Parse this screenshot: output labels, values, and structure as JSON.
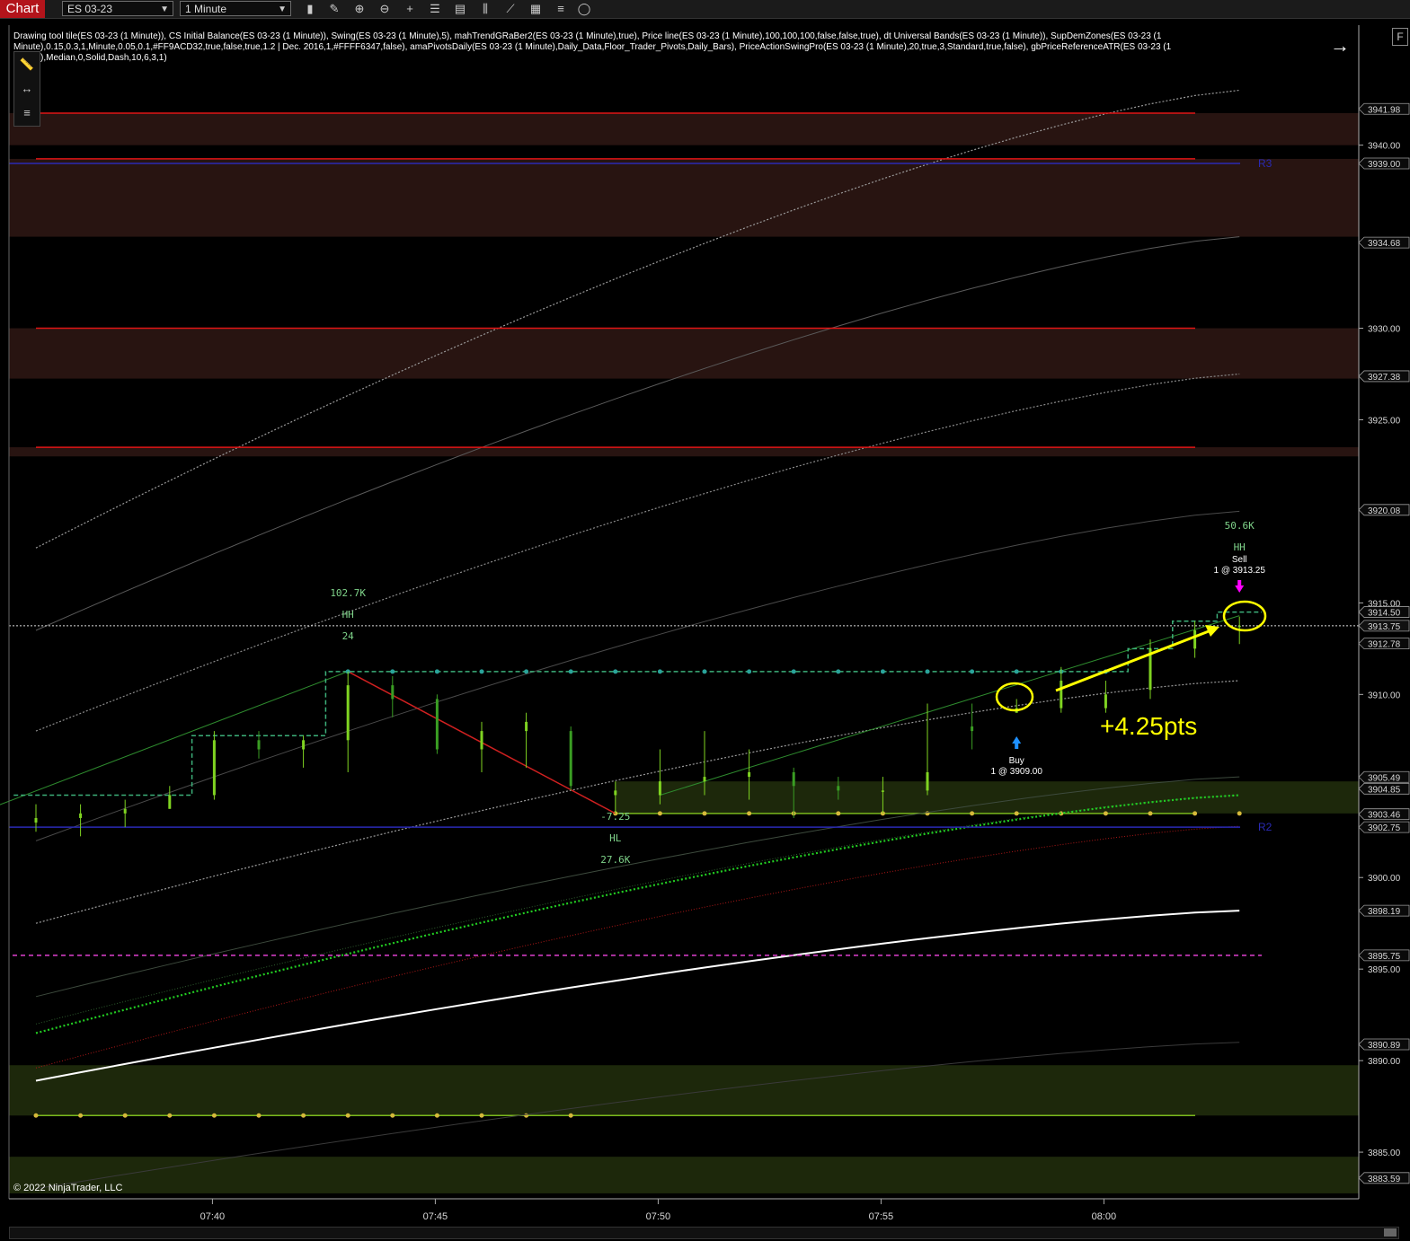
{
  "window": {
    "title": "Chart"
  },
  "toolbar": {
    "instrument": "ES 03-23",
    "interval": "1 Minute",
    "icons": [
      "bar-type-icon",
      "pencil-icon",
      "zoom-in-icon",
      "zoom-out-icon",
      "crosshair-icon",
      "properties-icon",
      "data-box-icon",
      "indicators-icon",
      "strategies-icon",
      "templates-icon",
      "list-icon",
      "chart-trader-icon"
    ]
  },
  "legend": {
    "text": "Drawing tool tile(ES 03-23 (1 Minute)), CS Initial Balance(ES 03-23 (1 Minute)), Swing(ES 03-23 (1 Minute),5), mahTrendGRaBer2(ES 03-23 (1 Minute),true), Price line(ES 03-23 (1 Minute),100,100,100,false,false,true), dt Universal Bands(ES 03-23 (1 Minute)), SupDemZones(ES 03-23 (1 Minute),0.15,0.3,1,Minute,0.05,0.1,#FF9ACD32,true,false,true,1.2 | Dec. 2016,1,#FFFF6347,false), amaPivotsDaily(ES 03-23 (1 Minute),Daily_Data,Floor_Trader_Pivots,Daily_Bars), PriceActionSwingPro(ES 03-23 (1 Minute),20,true,3,Standard,true,false), gbPriceReferenceATR(ES 03-23 (1 Minute),Median,0,Solid,Dash,10,6,3,1)"
  },
  "copyright": "© 2022 NinjaTrader, LLC",
  "colors": {
    "background": "#000000",
    "up_bar": "#7fd321",
    "down_bar": "#3a9d23",
    "resistance_zone": "#2a1512",
    "support_zone": "#1f2a0c",
    "pivot_line": "#2a2ab4",
    "price_line": "#ffffff",
    "annotation": "#ffff00",
    "sell_marker": "#ff00ff",
    "buy_marker": "#1e90ff"
  },
  "chart_data": {
    "type": "candlestick",
    "instrument": "ES 03-23",
    "interval": "1 Minute",
    "ylim": [
      3882.6,
      3944.2
    ],
    "x_ticks": [
      "07:40",
      "07:45",
      "07:50",
      "07:55",
      "08:00"
    ],
    "x_tick_bars": [
      4,
      9,
      14,
      19,
      24
    ],
    "y_ticks": [
      3885.0,
      3890.0,
      3895.0,
      3900.0,
      3910.0,
      3915.0,
      3925.0,
      3930.0,
      3940.0
    ],
    "price_labels": [
      {
        "price": 3941.98,
        "text": "3941.98",
        "color": "#d9d9d9"
      },
      {
        "price": 3939.0,
        "text": "3939.00",
        "color": "#d9d9d9"
      },
      {
        "price": 3934.68,
        "text": "3934.68",
        "color": "#d9d9d9"
      },
      {
        "price": 3927.38,
        "text": "3927.38",
        "color": "#d9d9d9"
      },
      {
        "price": 3920.08,
        "text": "3920.08",
        "color": "#d9d9d9"
      },
      {
        "price": 3914.5,
        "text": "3914.50",
        "color": "#d9d9d9"
      },
      {
        "price": 3913.75,
        "text": "3913.75",
        "color": "#d9d9d9"
      },
      {
        "price": 3912.78,
        "text": "3912.78",
        "color": "#d9d9d9"
      },
      {
        "price": 3905.49,
        "text": "3905.49",
        "color": "#d9d9d9"
      },
      {
        "price": 3904.85,
        "text": "3904.85",
        "color": "#d9d9d9"
      },
      {
        "price": 3903.46,
        "text": "3903.46",
        "color": "#d9d9d9"
      },
      {
        "price": 3902.75,
        "text": "3902.75",
        "color": "#d9d9d9"
      },
      {
        "price": 3898.19,
        "text": "3898.19",
        "color": "#d9d9d9"
      },
      {
        "price": 3895.75,
        "text": "3895.75",
        "color": "#d9d9d9"
      },
      {
        "price": 3890.89,
        "text": "3890.89",
        "color": "#d9d9d9"
      },
      {
        "price": 3883.59,
        "text": "3883.59",
        "color": "#d9d9d9"
      }
    ],
    "bars": [
      {
        "o": 3903.0,
        "h": 3904.0,
        "l": 3902.5,
        "c": 3903.25
      },
      {
        "o": 3903.25,
        "h": 3904.0,
        "l": 3902.25,
        "c": 3903.5
      },
      {
        "o": 3903.5,
        "h": 3904.25,
        "l": 3902.75,
        "c": 3903.75
      },
      {
        "o": 3903.75,
        "h": 3905.0,
        "l": 3903.75,
        "c": 3904.5
      },
      {
        "o": 3904.5,
        "h": 3908.0,
        "l": 3904.25,
        "c": 3907.5
      },
      {
        "o": 3907.5,
        "h": 3908.0,
        "l": 3906.5,
        "c": 3907.0
      },
      {
        "o": 3907.0,
        "h": 3907.75,
        "l": 3906.0,
        "c": 3907.5
      },
      {
        "o": 3907.5,
        "h": 3911.25,
        "l": 3905.75,
        "c": 3910.5
      },
      {
        "o": 3910.5,
        "h": 3911.0,
        "l": 3908.75,
        "c": 3909.75
      },
      {
        "o": 3909.75,
        "h": 3910.0,
        "l": 3906.75,
        "c": 3907.0
      },
      {
        "o": 3907.0,
        "h": 3908.5,
        "l": 3905.75,
        "c": 3908.0
      },
      {
        "o": 3908.0,
        "h": 3909.0,
        "l": 3906.0,
        "c": 3908.5
      },
      {
        "o": 3908.0,
        "h": 3908.25,
        "l": 3904.75,
        "c": 3905.0
      },
      {
        "o": 3904.5,
        "h": 3905.25,
        "l": 3903.5,
        "c": 3904.75
      },
      {
        "o": 3904.5,
        "h": 3907.0,
        "l": 3904.0,
        "c": 3905.25
      },
      {
        "o": 3905.25,
        "h": 3908.0,
        "l": 3904.5,
        "c": 3905.5
      },
      {
        "o": 3905.5,
        "h": 3907.0,
        "l": 3904.25,
        "c": 3905.75
      },
      {
        "o": 3905.75,
        "h": 3906.0,
        "l": 3903.25,
        "c": 3905.0
      },
      {
        "o": 3905.0,
        "h": 3905.5,
        "l": 3904.25,
        "c": 3904.75
      },
      {
        "o": 3904.75,
        "h": 3905.5,
        "l": 3903.5,
        "c": 3904.75
      },
      {
        "o": 3904.75,
        "h": 3909.5,
        "l": 3904.5,
        "c": 3905.75
      },
      {
        "o": 3908.25,
        "h": 3909.5,
        "l": 3907.0,
        "c": 3908.0
      },
      {
        "o": 3909.0,
        "h": 3909.75,
        "l": 3909.0,
        "c": 3909.25
      },
      {
        "o": 3909.25,
        "h": 3911.5,
        "l": 3909.0,
        "c": 3910.75
      },
      {
        "o": 3909.25,
        "h": 3910.75,
        "l": 3909.0,
        "c": 3910.0
      },
      {
        "o": 3910.25,
        "h": 3913.0,
        "l": 3909.75,
        "c": 3912.5
      },
      {
        "o": 3912.5,
        "h": 3914.0,
        "l": 3912.0,
        "c": 3913.5
      },
      {
        "o": 3913.75,
        "h": 3914.25,
        "l": 3912.75,
        "c": 3913.75
      }
    ],
    "zones": [
      {
        "kind": "resistance",
        "from": 3940.0,
        "to": 3941.75
      },
      {
        "kind": "resistance",
        "from": 3935.0,
        "to": 3939.25
      },
      {
        "kind": "resistance",
        "from": 3927.25,
        "to": 3930.0
      },
      {
        "kind": "resistance",
        "from": 3923.0,
        "to": 3923.5
      },
      {
        "kind": "support",
        "from": 3903.5,
        "to": 3905.25,
        "start_bar": 13
      },
      {
        "kind": "support",
        "from": 3887.0,
        "to": 3889.75
      },
      {
        "kind": "support",
        "from": 3882.75,
        "to": 3884.75
      }
    ],
    "red_lines": [
      3941.75,
      3939.25,
      3930.0,
      3923.5
    ],
    "pivot_lines": [
      {
        "price": 3939.0,
        "label": "R3"
      },
      {
        "price": 3902.75,
        "label": "R2"
      }
    ],
    "price_line": 3913.75,
    "magenta_line": 3895.75,
    "white_trend": [
      3888.9,
      3898.19
    ],
    "swing_line": [
      {
        "bar": 7,
        "price": 3911.25
      },
      {
        "bar": 13,
        "price": 3903.5
      }
    ],
    "swing_labels": [
      {
        "bar": 7,
        "lines": [
          "102.7K",
          "HH",
          "24"
        ]
      },
      {
        "bar": 13,
        "lines": [
          "-7.25",
          "HL",
          "27.6K"
        ]
      },
      {
        "bar": 27,
        "lines": [
          "50.6K",
          "HH"
        ]
      }
    ],
    "orders": [
      {
        "side": "Buy",
        "bar": 22,
        "text": "1 @ 3909.00"
      },
      {
        "side": "Sell",
        "bar": 27,
        "text": "1 @ 3913.25"
      }
    ],
    "annotation": "+4.25pts"
  }
}
